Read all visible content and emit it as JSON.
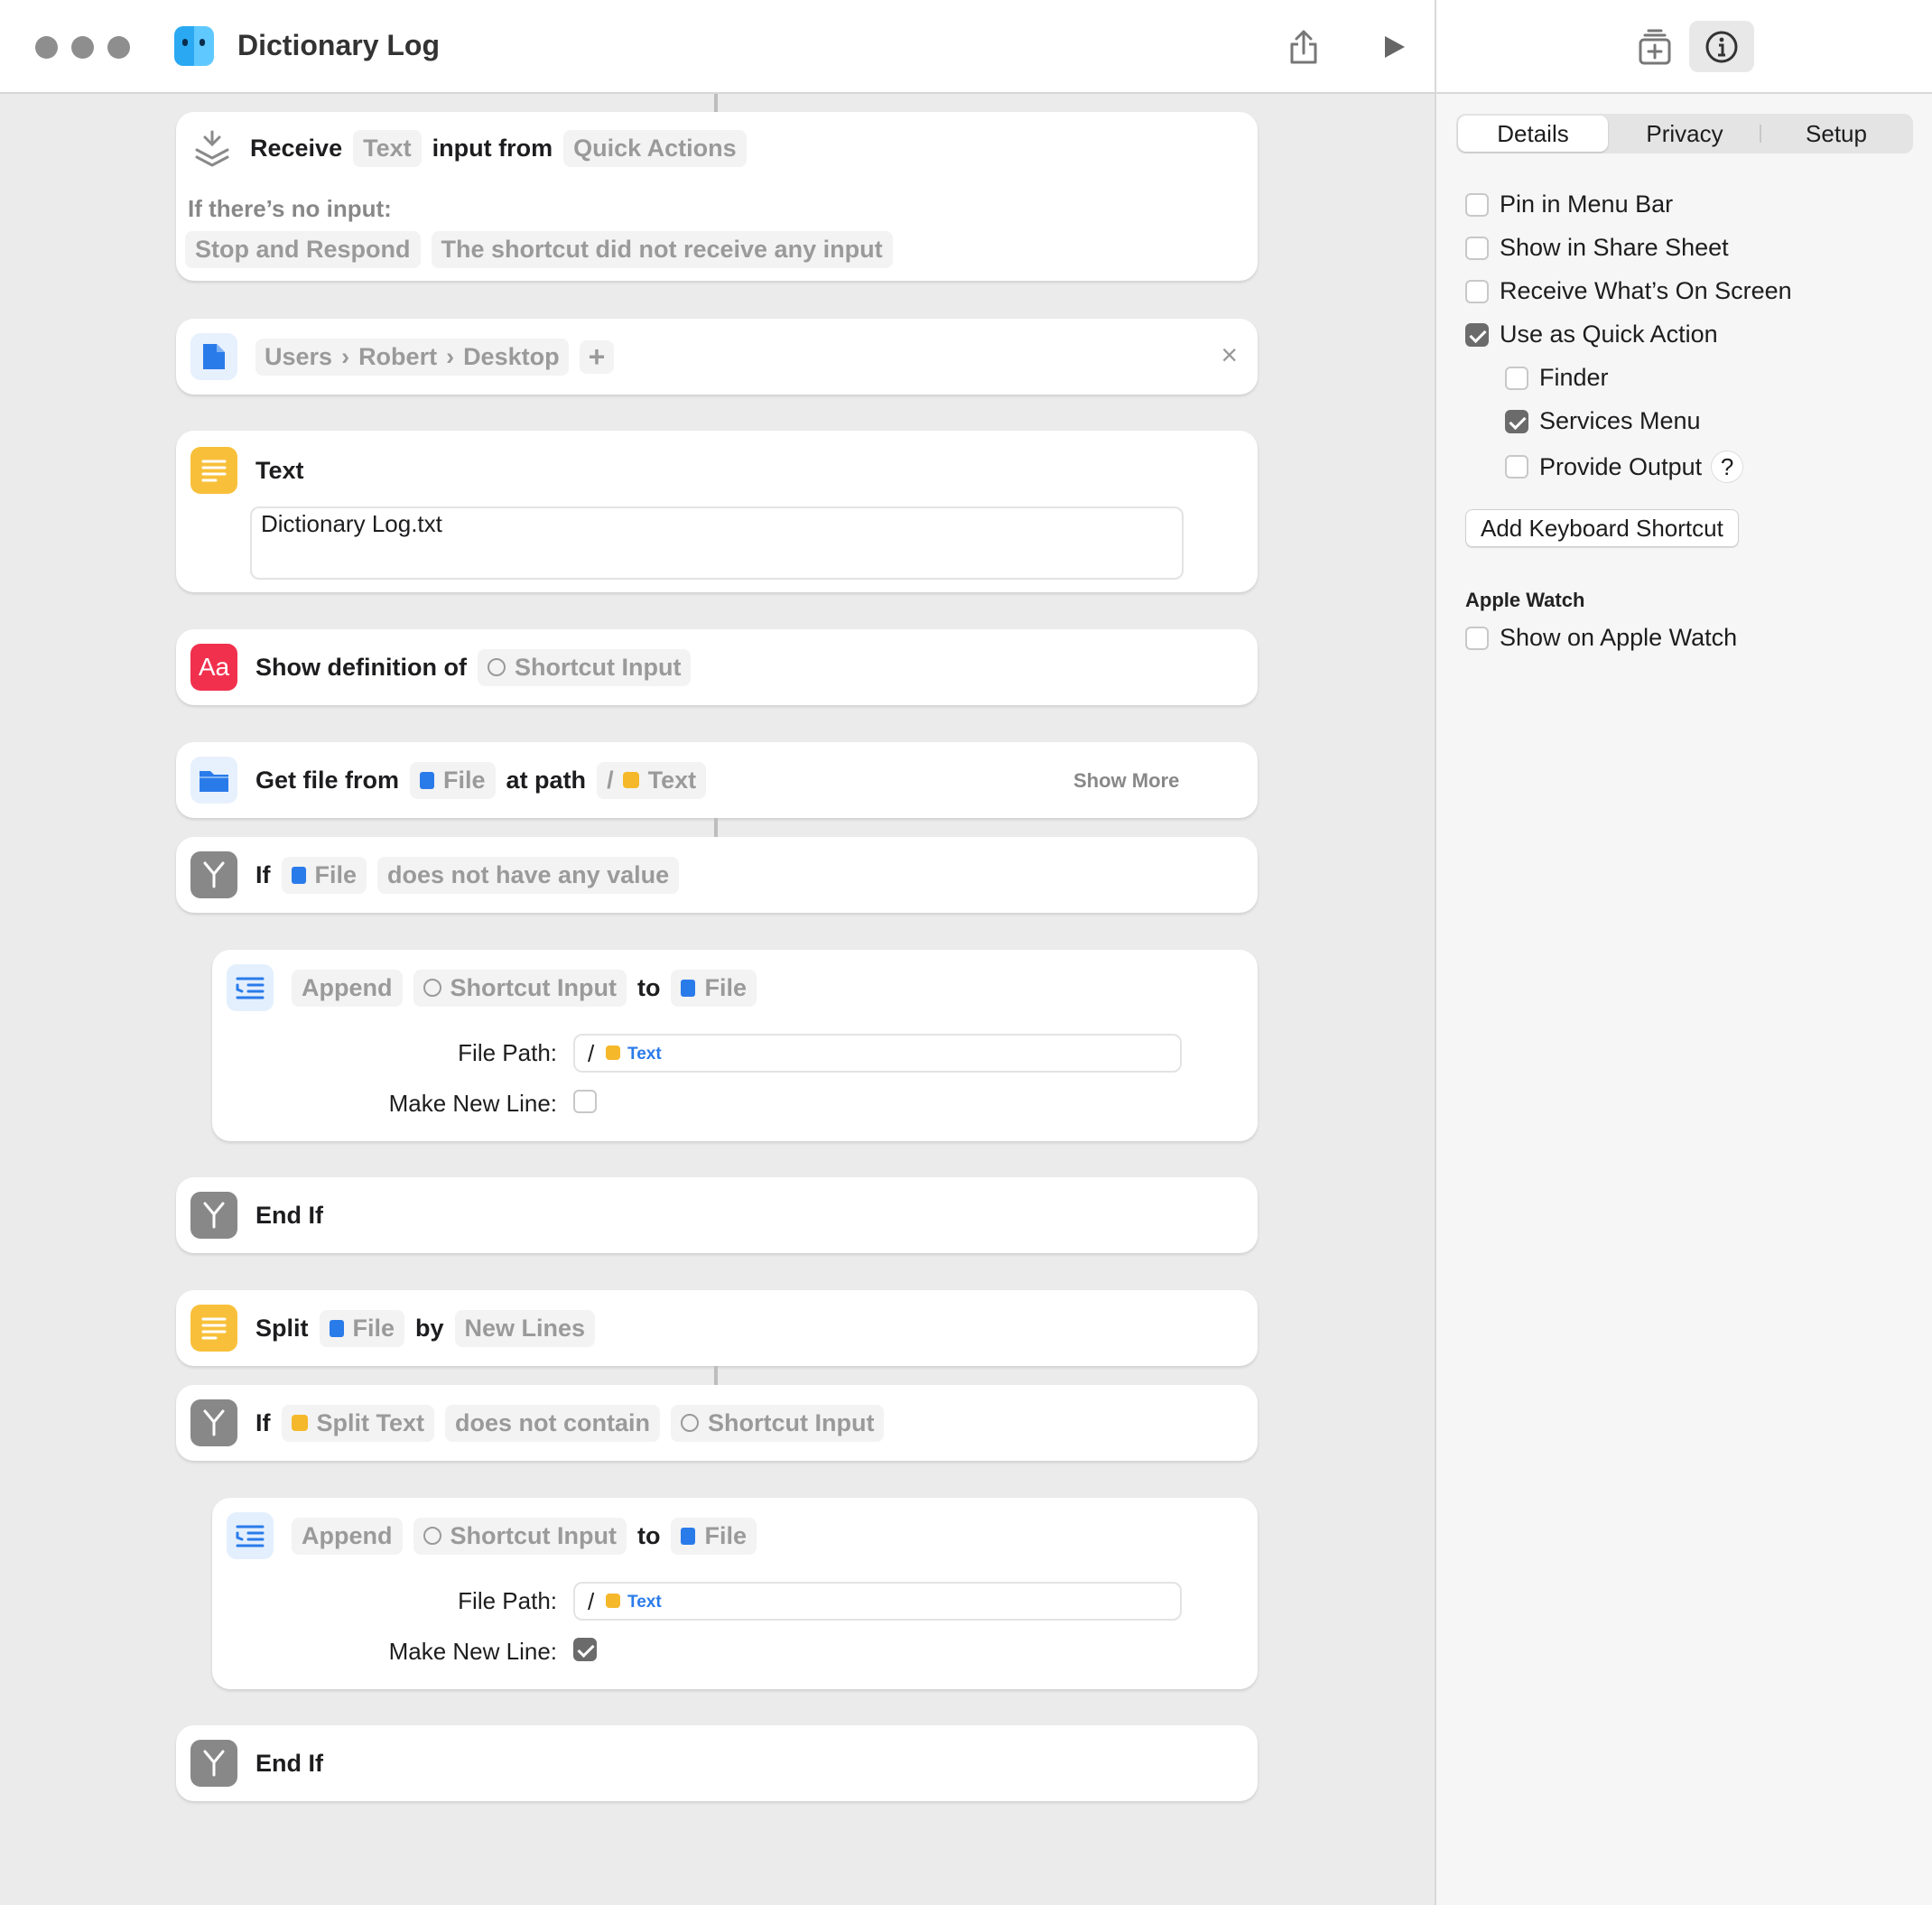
{
  "window": {
    "title": "Dictionary Log"
  },
  "toolbar": {
    "share_icon": "share-icon",
    "run_icon": "play-icon"
  },
  "actions": {
    "receive": {
      "kw_receive": "Receive",
      "input_type": "Text",
      "kw_from": "input from",
      "source": "Quick Actions",
      "no_input_label": "If there’s no input:",
      "no_input_action": "Stop and Respond",
      "no_input_message": "The shortcut did not receive any input"
    },
    "file_path": {
      "crumbs": [
        "Users",
        "Robert",
        "Desktop"
      ],
      "add": "+",
      "close": "×"
    },
    "text": {
      "title": "Text",
      "value": "Dictionary Log.txt"
    },
    "show_definition": {
      "kw": "Show definition of",
      "input": "Shortcut Input"
    },
    "get_file": {
      "kw": "Get file from",
      "file": "File",
      "kw_path": "at path",
      "slash": "/",
      "text": "Text",
      "show_more": "Show More"
    },
    "if1": {
      "kw": "If",
      "file": "File",
      "condition": "does not have any value"
    },
    "append1": {
      "kw": "Append",
      "input": "Shortcut Input",
      "kw_to": "to",
      "file": "File",
      "path_label": "File Path:",
      "path_slash": "/",
      "path_text": "Text",
      "newline_label": "Make New Line:",
      "newline": false
    },
    "endif1": {
      "kw": "End If"
    },
    "split": {
      "kw": "Split",
      "file": "File",
      "kw_by": "by",
      "sep": "New Lines"
    },
    "if2": {
      "kw": "If",
      "var": "Split Text",
      "condition": "does not contain",
      "input": "Shortcut Input"
    },
    "append2": {
      "kw": "Append",
      "input": "Shortcut Input",
      "kw_to": "to",
      "file": "File",
      "path_label": "File Path:",
      "path_slash": "/",
      "path_text": "Text",
      "newline_label": "Make New Line:",
      "newline": true
    },
    "endif2": {
      "kw": "End If"
    }
  },
  "sidebar": {
    "tabs": [
      "Details",
      "Privacy",
      "Setup"
    ],
    "active_tab": "Details",
    "options": [
      {
        "label": "Pin in Menu Bar",
        "checked": false
      },
      {
        "label": "Show in Share Sheet",
        "checked": false
      },
      {
        "label": "Receive What’s On Screen",
        "checked": false
      },
      {
        "label": "Use as Quick Action",
        "checked": true
      },
      {
        "label": "Finder",
        "checked": false
      },
      {
        "label": "Services Menu",
        "checked": true
      },
      {
        "label": "Provide Output",
        "checked": false
      }
    ],
    "help": "?",
    "keyboard_shortcut_button": "Add Keyboard Shortcut",
    "watch_heading": "Apple Watch",
    "watch_option": {
      "label": "Show on Apple Watch",
      "checked": false
    }
  },
  "colors": {
    "accent_blue": "#2a7bea",
    "text_yellow": "#f5b82a",
    "dictionary_red": "#f1304d",
    "control_gray": "#888888"
  }
}
